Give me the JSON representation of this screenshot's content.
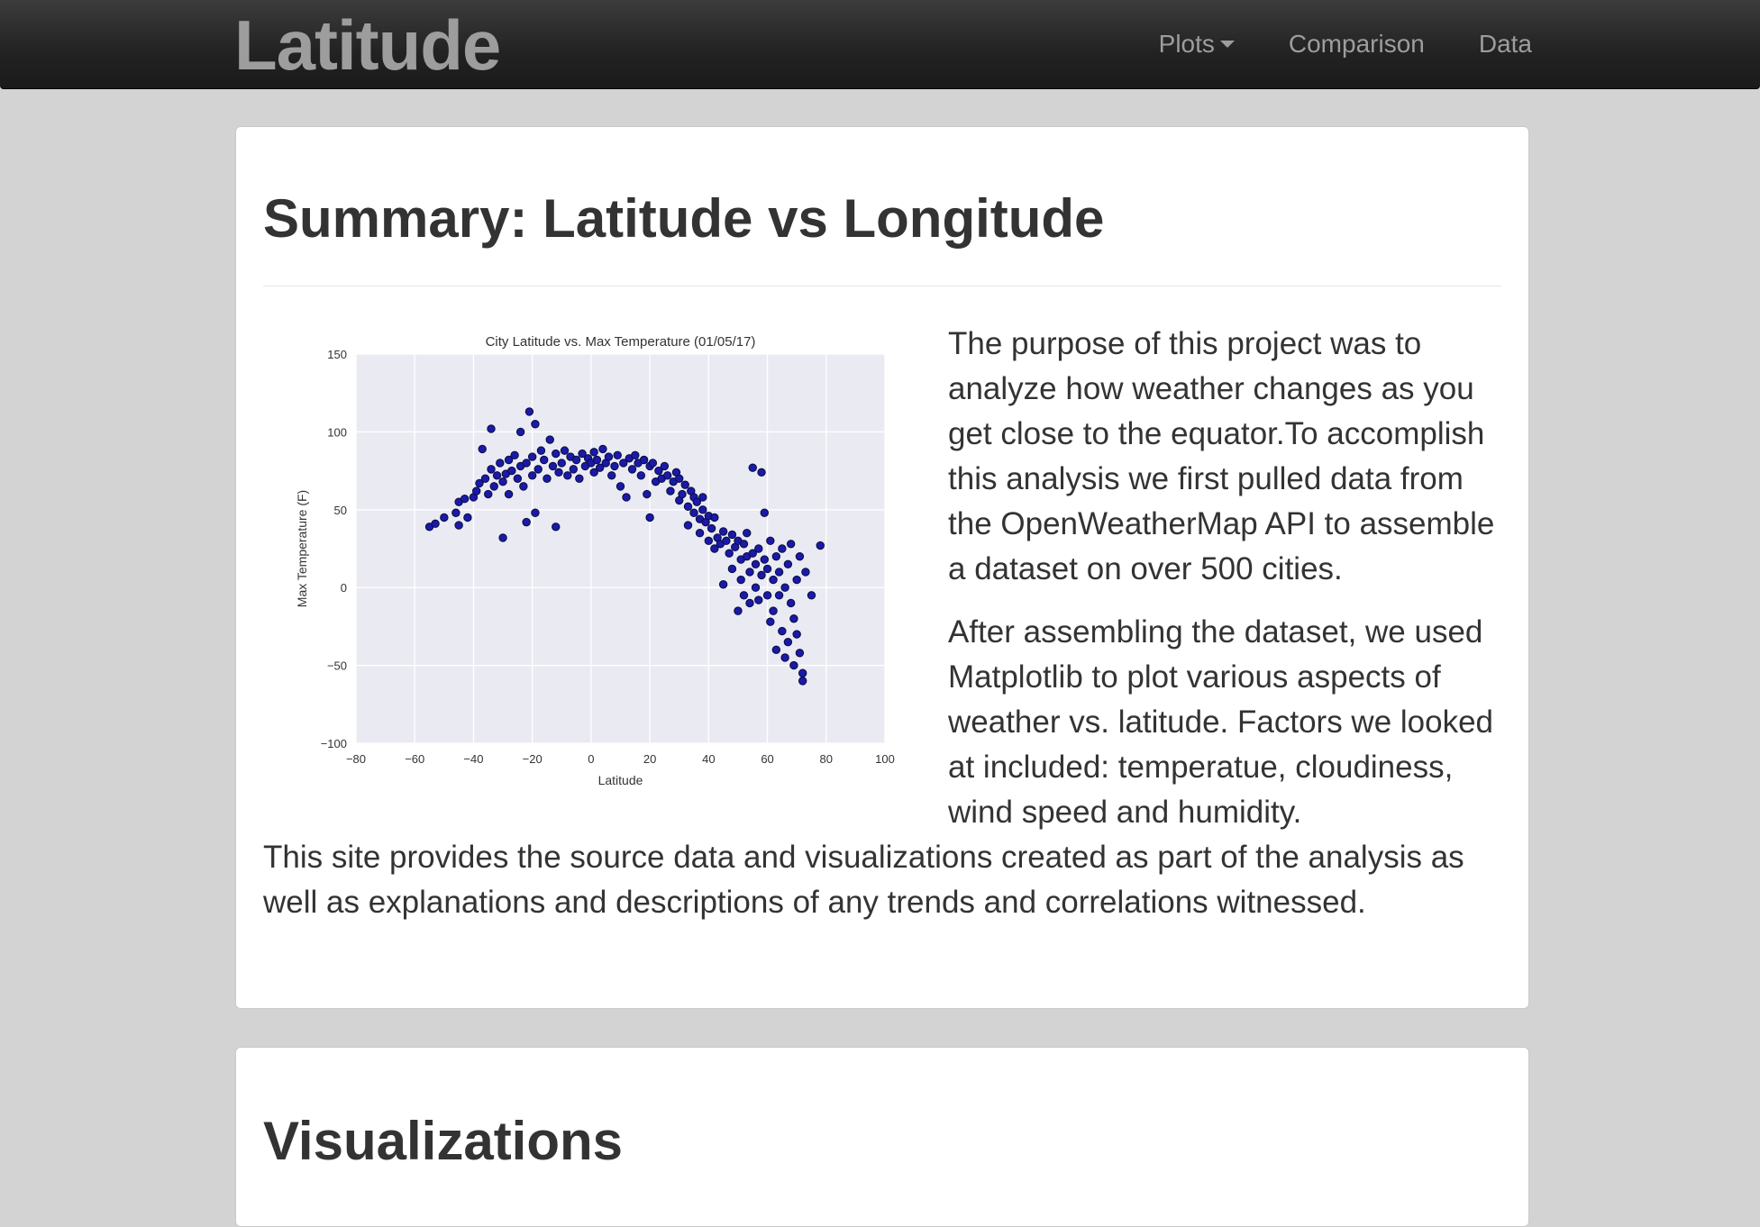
{
  "nav": {
    "brand": "Latitude",
    "items": [
      {
        "label": "Plots",
        "dropdown": true
      },
      {
        "label": "Comparison",
        "dropdown": false
      },
      {
        "label": "Data",
        "dropdown": false
      }
    ]
  },
  "summary": {
    "title": "Summary: Latitude vs Longitude",
    "paragraph1": "The purpose of this project was to analyze how weather changes as you get close to the equator.To accomplish this analysis we first pulled data from the OpenWeatherMap API to assemble a dataset on over 500 cities.",
    "paragraph2": "After assembling the dataset, we used Matplotlib to plot various aspects of weather vs. latitude. Factors we looked at included: temperatue, cloudiness, wind speed and humidity.",
    "paragraph3": "This site provides the source data and visualizations created as part of the analysis as well as explanations and descriptions of any trends and correlations witnessed."
  },
  "visualizations": {
    "title": "Visualizations"
  },
  "colors": {
    "navbar_bg": "#222222",
    "nav_text": "#9d9d9d",
    "page_bg": "#d3d3d3",
    "plot_bg": "#eaeaf2",
    "point_fill": "#1a1aa8"
  },
  "chart_data": {
    "type": "scatter",
    "title": "City Latitude vs. Max Temperature (01/05/17)",
    "xlabel": "Latitude",
    "ylabel": "Max Temperature (F)",
    "xlim": [
      -80,
      100
    ],
    "ylim": [
      -100,
      150
    ],
    "xticks": [
      -80,
      -60,
      -40,
      -20,
      0,
      20,
      40,
      60,
      80,
      100
    ],
    "yticks": [
      -100,
      -50,
      0,
      50,
      100,
      150
    ],
    "xtick_labels": [
      "−80",
      "−60",
      "−40",
      "−20",
      "0",
      "20",
      "40",
      "60",
      "80",
      "100"
    ],
    "ytick_labels": [
      "−100",
      "−50",
      "0",
      "50",
      "100",
      "150"
    ],
    "grid": true,
    "points": [
      [
        -55,
        39
      ],
      [
        -53,
        41
      ],
      [
        -50,
        45
      ],
      [
        -46,
        48
      ],
      [
        -45,
        55
      ],
      [
        -45,
        40
      ],
      [
        -43,
        57
      ],
      [
        -42,
        45
      ],
      [
        -40,
        58
      ],
      [
        -39,
        62
      ],
      [
        -38,
        67
      ],
      [
        -37,
        89
      ],
      [
        -36,
        70
      ],
      [
        -35,
        60
      ],
      [
        -34,
        76
      ],
      [
        -34,
        102
      ],
      [
        -33,
        65
      ],
      [
        -32,
        72
      ],
      [
        -31,
        80
      ],
      [
        -30,
        68
      ],
      [
        -30,
        32
      ],
      [
        -29,
        73
      ],
      [
        -28,
        82
      ],
      [
        -28,
        60
      ],
      [
        -27,
        75
      ],
      [
        -26,
        85
      ],
      [
        -25,
        70
      ],
      [
        -24,
        78
      ],
      [
        -24,
        100
      ],
      [
        -23,
        65
      ],
      [
        -22,
        80
      ],
      [
        -22,
        42
      ],
      [
        -21,
        113
      ],
      [
        -20,
        84
      ],
      [
        -20,
        72
      ],
      [
        -19,
        105
      ],
      [
        -19,
        48
      ],
      [
        -18,
        76
      ],
      [
        -17,
        88
      ],
      [
        -16,
        82
      ],
      [
        -15,
        70
      ],
      [
        -14,
        95
      ],
      [
        -13,
        78
      ],
      [
        -12,
        86
      ],
      [
        -12,
        39
      ],
      [
        -11,
        74
      ],
      [
        -10,
        80
      ],
      [
        -9,
        88
      ],
      [
        -8,
        72
      ],
      [
        -7,
        84
      ],
      [
        -6,
        76
      ],
      [
        -5,
        82
      ],
      [
        -4,
        70
      ],
      [
        -3,
        86
      ],
      [
        -2,
        78
      ],
      [
        -1,
        83
      ],
      [
        0,
        80
      ],
      [
        1,
        74
      ],
      [
        1,
        87
      ],
      [
        2,
        82
      ],
      [
        3,
        77
      ],
      [
        4,
        89
      ],
      [
        5,
        80
      ],
      [
        6,
        84
      ],
      [
        7,
        72
      ],
      [
        8,
        78
      ],
      [
        9,
        85
      ],
      [
        10,
        65
      ],
      [
        11,
        80
      ],
      [
        12,
        58
      ],
      [
        13,
        83
      ],
      [
        14,
        76
      ],
      [
        15,
        85
      ],
      [
        16,
        80
      ],
      [
        17,
        72
      ],
      [
        18,
        82
      ],
      [
        19,
        60
      ],
      [
        20,
        78
      ],
      [
        20,
        45
      ],
      [
        21,
        80
      ],
      [
        22,
        68
      ],
      [
        23,
        75
      ],
      [
        24,
        70
      ],
      [
        25,
        78
      ],
      [
        26,
        72
      ],
      [
        27,
        62
      ],
      [
        28,
        68
      ],
      [
        29,
        74
      ],
      [
        30,
        70
      ],
      [
        30,
        56
      ],
      [
        31,
        60
      ],
      [
        32,
        66
      ],
      [
        33,
        52
      ],
      [
        33,
        40
      ],
      [
        34,
        62
      ],
      [
        35,
        48
      ],
      [
        35,
        58
      ],
      [
        36,
        55
      ],
      [
        37,
        44
      ],
      [
        37,
        35
      ],
      [
        38,
        50
      ],
      [
        38,
        58
      ],
      [
        39,
        42
      ],
      [
        40,
        46
      ],
      [
        40,
        30
      ],
      [
        41,
        38
      ],
      [
        42,
        45
      ],
      [
        42,
        25
      ],
      [
        43,
        32
      ],
      [
        44,
        28
      ],
      [
        45,
        36
      ],
      [
        45,
        2
      ],
      [
        46,
        30
      ],
      [
        47,
        22
      ],
      [
        48,
        34
      ],
      [
        48,
        12
      ],
      [
        49,
        26
      ],
      [
        50,
        30
      ],
      [
        50,
        -15
      ],
      [
        51,
        18
      ],
      [
        51,
        5
      ],
      [
        52,
        28
      ],
      [
        52,
        -5
      ],
      [
        53,
        20
      ],
      [
        53,
        35
      ],
      [
        54,
        10
      ],
      [
        54,
        -10
      ],
      [
        55,
        22
      ],
      [
        55,
        77
      ],
      [
        56,
        0
      ],
      [
        56,
        15
      ],
      [
        57,
        25
      ],
      [
        57,
        -8
      ],
      [
        58,
        8
      ],
      [
        58,
        74
      ],
      [
        59,
        18
      ],
      [
        59,
        48
      ],
      [
        60,
        -5
      ],
      [
        60,
        12
      ],
      [
        61,
        -22
      ],
      [
        61,
        30
      ],
      [
        62,
        5
      ],
      [
        62,
        -15
      ],
      [
        63,
        20
      ],
      [
        63,
        -40
      ],
      [
        64,
        -5
      ],
      [
        64,
        10
      ],
      [
        65,
        -28
      ],
      [
        65,
        25
      ],
      [
        66,
        0
      ],
      [
        66,
        -45
      ],
      [
        67,
        15
      ],
      [
        67,
        -35
      ],
      [
        68,
        -10
      ],
      [
        68,
        28
      ],
      [
        69,
        -20
      ],
      [
        69,
        -50
      ],
      [
        70,
        5
      ],
      [
        70,
        -30
      ],
      [
        71,
        -42
      ],
      [
        71,
        20
      ],
      [
        72,
        -55
      ],
      [
        72,
        -60
      ],
      [
        73,
        10
      ],
      [
        75,
        -5
      ],
      [
        78,
        27
      ]
    ]
  }
}
